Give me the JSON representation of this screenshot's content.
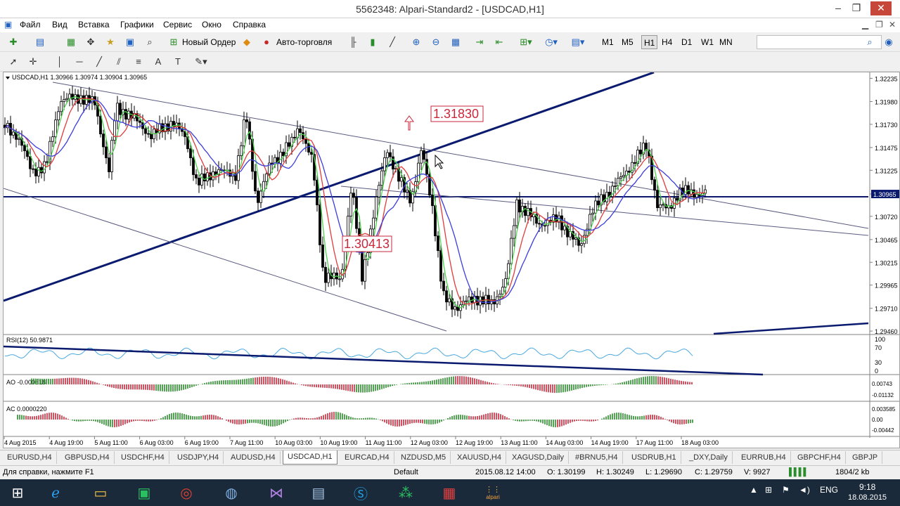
{
  "window": {
    "title": "5562348: Alpari-Standard2 - [USDCAD,H1]",
    "min": "‒",
    "restore": "❐",
    "close": "✕"
  },
  "menu": [
    "Файл",
    "Вид",
    "Вставка",
    "Графики",
    "Сервис",
    "Окно",
    "Справка"
  ],
  "toolbar": {
    "new_order": "Новый Ордер",
    "auto_trading": "Авто-торговля",
    "timeframes": [
      "M1",
      "M5",
      "H1",
      "H4",
      "D1",
      "W1",
      "MN"
    ]
  },
  "chart": {
    "header": "USDCAD,H1  1.30966 1.30974 1.30904 1.30965",
    "price_labels": [
      "1.32235",
      "1.31980",
      "1.31730",
      "1.31475",
      "1.31225",
      "1.30965",
      "1.30720",
      "1.30465",
      "1.30215",
      "1.29965",
      "1.29710",
      "1.29460"
    ],
    "current_price": "1.30965",
    "annot_high": "1.31830",
    "annot_low": "1.30413",
    "rsi_label": "RSI(12) 50.9871",
    "rsi_levels": [
      "100",
      "70",
      "30",
      "0"
    ],
    "ao_label": "AO -0.000818",
    "ao_levels": [
      "0.00743",
      "-0.01132"
    ],
    "ac_label": "AC 0.0000220",
    "ac_levels": [
      "0.003585",
      "0.00",
      "-0.00442"
    ],
    "time_labels": [
      "4 Aug 2015",
      "4 Aug 19:00",
      "5 Aug 11:00",
      "6 Aug 03:00",
      "6 Aug 19:00",
      "7 Aug 11:00",
      "10 Aug 03:00",
      "10 Aug 19:00",
      "11 Aug 11:00",
      "12 Aug 03:00",
      "12 Aug 19:00",
      "13 Aug 11:00",
      "14 Aug 03:00",
      "14 Aug 19:00",
      "17 Aug 11:00",
      "18 Aug 03:00"
    ]
  },
  "tabs": [
    "EURUSD,H4",
    "GBPUSD,H4",
    "USDCHF,H4",
    "USDJPY,H4",
    "AUDUSD,H4",
    "USDCAD,H1",
    "EURCAD,H4",
    "NZDUSD,M5",
    "XAUUSD,H4",
    "XAGUSD,Daily",
    "#BRNU5,H4",
    "USDRUB,H1",
    "_DXY,Daily",
    "EURRUB,H4",
    "GBPCHF,H4",
    "GBPJP"
  ],
  "active_tab": "USDCAD,H1",
  "status": {
    "help": "Для справки, нажмите F1",
    "profile": "Default",
    "time": "2015.08.12 14:00",
    "open": "O: 1.30199",
    "high": "H: 1.30249",
    "low": "L: 1.29690",
    "close": "C: 1.29759",
    "volume": "V: 9927",
    "traffic": "1804/2 kb"
  },
  "taskbar": {
    "lang": "ENG",
    "clock": "9:18",
    "date": "18.08.2015",
    "app_label": "alpari"
  },
  "colors": {
    "bg": "#ffffff",
    "trend": "#0a1a6e",
    "bull": "#2a8c2a",
    "bear": "#c8283c",
    "ma_fast": "#4fd24f",
    "ma_mid": "#e03c3c",
    "ma_slow": "#3c3cdc",
    "rsi": "#4aa8e0"
  }
}
